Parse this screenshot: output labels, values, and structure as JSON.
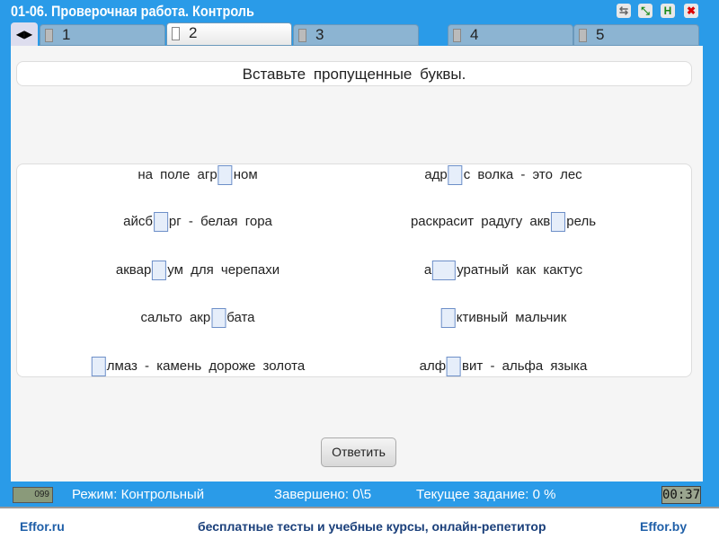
{
  "window": {
    "title": "01-06. Проверочная работа. Контроль",
    "buttons": [
      "share",
      "fullscreen",
      "save",
      "close"
    ]
  },
  "tabs": [
    {
      "label": "1"
    },
    {
      "label": "2",
      "active": true
    },
    {
      "label": "3"
    },
    {
      "label": "4"
    },
    {
      "label": "5"
    }
  ],
  "instruction": "Вставьте пропущенные буквы.",
  "items_left": [
    {
      "before": "на поле агр",
      "after": "ном"
    },
    {
      "before": "айсб",
      "after": "рг - белая гора"
    },
    {
      "before": "аквар",
      "after": "ум для черепахи"
    },
    {
      "before": "сальто акр",
      "after": "бата"
    },
    {
      "before": "",
      "after": "лмаз - камень дороже золота"
    }
  ],
  "items_right": [
    {
      "before": "адр",
      "after": "с волка - это лес"
    },
    {
      "before": "раскрасит радугу акв",
      "after": "рель"
    },
    {
      "before": "а",
      "after": "уратный как кактус"
    },
    {
      "before": "",
      "after": "ктивный мальчик"
    },
    {
      "before": "алф",
      "after": "вит - альфа языка"
    }
  ],
  "answer_button": "Ответить",
  "status": {
    "counter": "099",
    "mode": "Режим: Контрольный",
    "completed": "Завершено: 0\\5",
    "current": "Текущее задание: 0 %",
    "timer": "00:37"
  },
  "footer": {
    "left": "Effor.ru",
    "center": "бесплатные тесты и учебные курсы, онлайн-репетитор",
    "right": "Effor.by"
  }
}
